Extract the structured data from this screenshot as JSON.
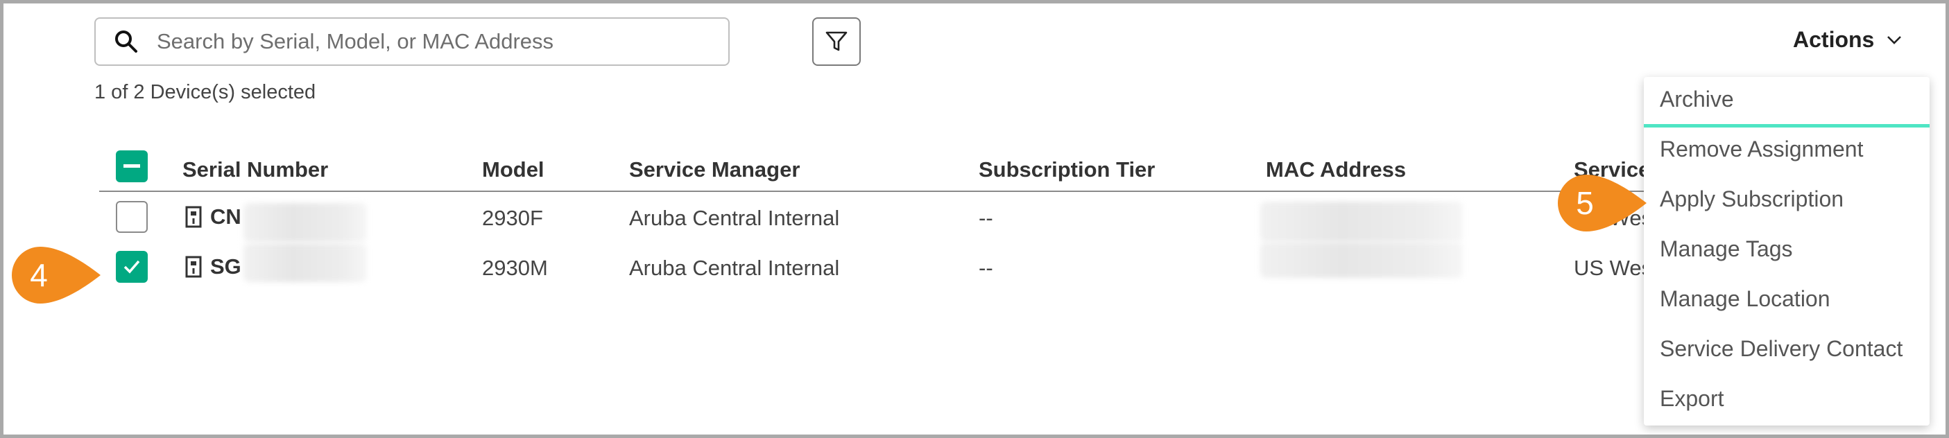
{
  "search": {
    "placeholder": "Search by Serial, Model, or MAC Address"
  },
  "toolbar": {
    "actions_label": "Actions"
  },
  "selection": {
    "count_text": "1 of 2 Device(s) selected"
  },
  "table": {
    "headers": [
      "Serial Number",
      "Model",
      "Service Manager",
      "Subscription Tier",
      "MAC Address",
      "Service"
    ],
    "rows": [
      {
        "serial": "CN",
        "model": "2930F",
        "service_manager": "Aruba Central Internal",
        "tier": "--",
        "region": "US West",
        "checked": false
      },
      {
        "serial": "SG",
        "model": "2930M",
        "service_manager": "Aruba Central Internal",
        "tier": "--",
        "region": "US West",
        "checked": true
      }
    ]
  },
  "menu": {
    "items": [
      "Archive",
      "Remove Assignment",
      "Apply Subscription",
      "Manage Tags",
      "Manage Location",
      "Service Delivery Contact",
      "Export"
    ]
  },
  "callouts": {
    "left": "4",
    "right": "5"
  },
  "colors": {
    "accent": "#01a982",
    "callout": "#f28b1e",
    "menu_focus": "#4fe5c4"
  }
}
